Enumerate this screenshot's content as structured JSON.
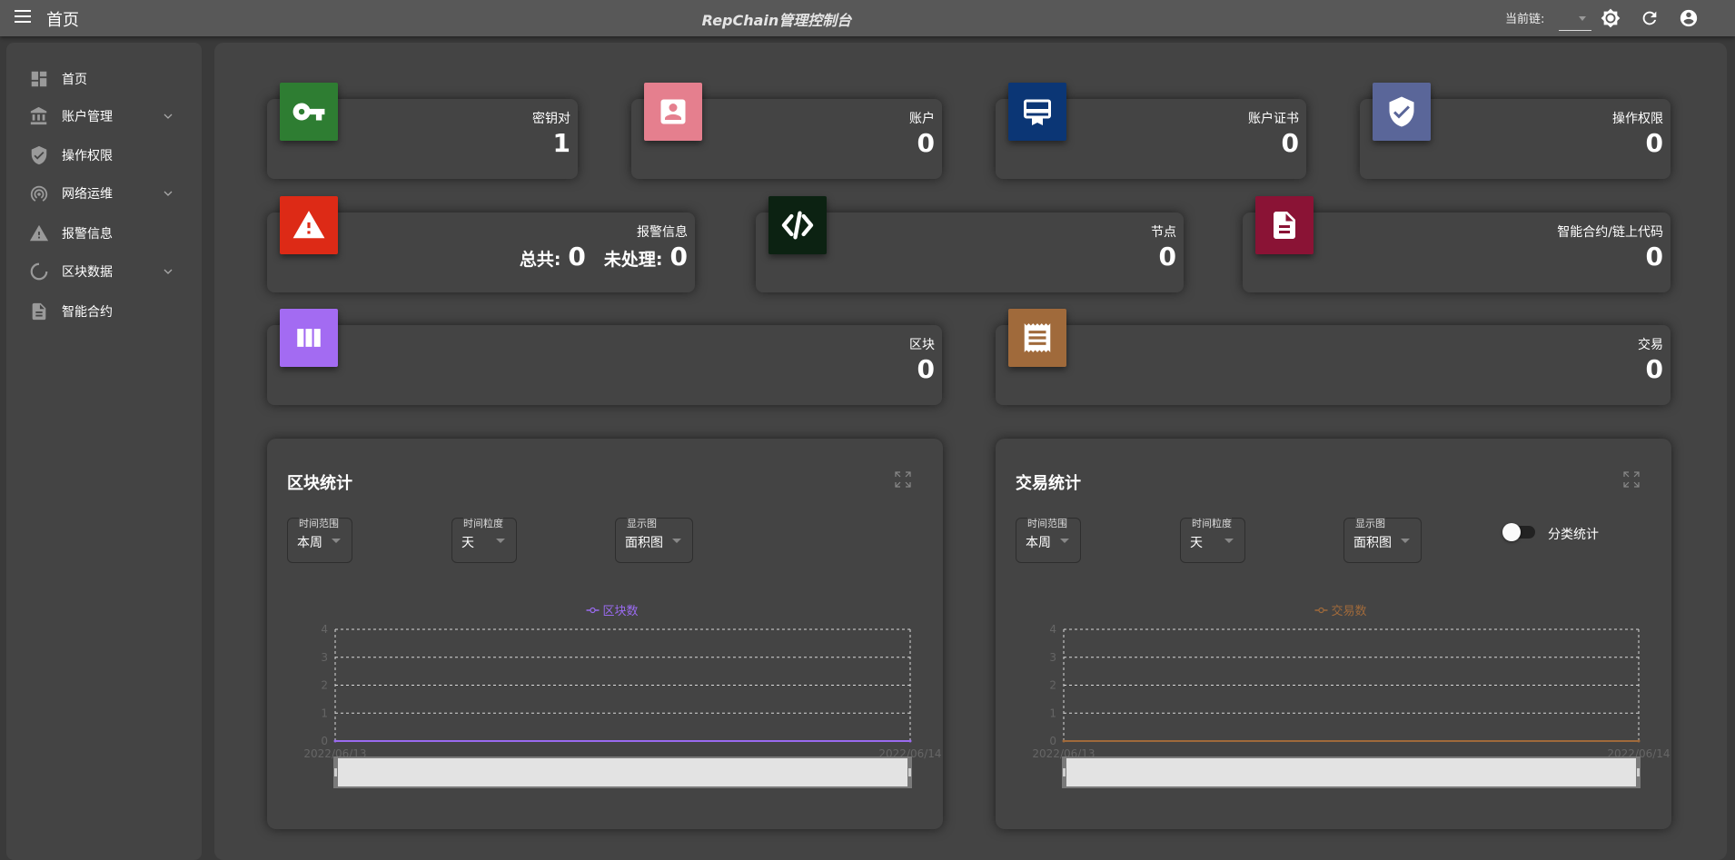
{
  "header": {
    "page_title": "首页",
    "app_title": "RepChain管理控制台",
    "chain_label": "当前链:",
    "chain_value": ""
  },
  "sidebar": {
    "items": [
      {
        "label": "首页",
        "icon": "dashboard-icon",
        "expandable": false
      },
      {
        "label": "账户管理",
        "icon": "bank-icon",
        "expandable": true
      },
      {
        "label": "操作权限",
        "icon": "shield-icon",
        "expandable": false
      },
      {
        "label": "网络运维",
        "icon": "network-icon",
        "expandable": true
      },
      {
        "label": "报警信息",
        "icon": "warning-icon",
        "expandable": false
      },
      {
        "label": "区块数据",
        "icon": "loading-circle-icon",
        "expandable": true
      },
      {
        "label": "智能合约",
        "icon": "document-icon",
        "expandable": false
      }
    ]
  },
  "stats": {
    "keypair": {
      "label": "密钥对",
      "value": "1",
      "color": "#2e7d32",
      "icon": "key-icon"
    },
    "account": {
      "label": "账户",
      "value": "0",
      "color": "#e57f8e",
      "icon": "contact-icon"
    },
    "cert": {
      "label": "账户证书",
      "value": "0",
      "color": "#0b3675",
      "icon": "certificate-icon"
    },
    "permission": {
      "label": "操作权限",
      "value": "0",
      "color": "#5a6699",
      "icon": "shield-check-icon"
    },
    "alarm": {
      "label": "报警信息",
      "total_label": "总共:",
      "total": "0",
      "pending_label": "未处理:",
      "pending": "0",
      "color": "#dd2a16",
      "icon": "warning-icon"
    },
    "node": {
      "label": "节点",
      "value": "0",
      "color": "#0c2212",
      "icon": "code-icon"
    },
    "contract": {
      "label": "智能合约/链上代码",
      "value": "0",
      "color": "#8a1335",
      "icon": "document-icon"
    },
    "block": {
      "label": "区块",
      "value": "0",
      "color": "#a36bf2",
      "icon": "columns-icon"
    },
    "tx": {
      "label": "交易",
      "value": "0",
      "color": "#a06a3b",
      "icon": "receipt-icon"
    }
  },
  "panels": {
    "block": {
      "title": "区块统计",
      "range_caption": "时间范围",
      "range_value": "本周",
      "gran_caption": "时间粒度",
      "gran_value": "天",
      "view_caption": "显示图",
      "view_value": "面积图"
    },
    "tx": {
      "title": "交易统计",
      "range_caption": "时间范围",
      "range_value": "本周",
      "gran_caption": "时间粒度",
      "gran_value": "天",
      "view_caption": "显示图",
      "view_value": "面积图",
      "toggle_label": "分类统计"
    }
  },
  "chart_data": [
    {
      "type": "area",
      "x": [
        "2022/06/13",
        "2022/06/14"
      ],
      "series": [
        {
          "name": "区块数",
          "values": [
            0,
            0
          ],
          "color": "#9a6bf0"
        }
      ],
      "yticks": [
        0,
        1,
        2,
        3,
        4
      ],
      "ylim": [
        0,
        4
      ],
      "grid": true,
      "legend": "top-center"
    },
    {
      "type": "area",
      "x": [
        "2022/06/13",
        "2022/06/14"
      ],
      "series": [
        {
          "name": "交易数",
          "values": [
            0,
            0
          ],
          "color": "#a06a3b"
        }
      ],
      "yticks": [
        0,
        1,
        2,
        3,
        4
      ],
      "ylim": [
        0,
        4
      ],
      "grid": true,
      "legend": "top-center"
    }
  ]
}
